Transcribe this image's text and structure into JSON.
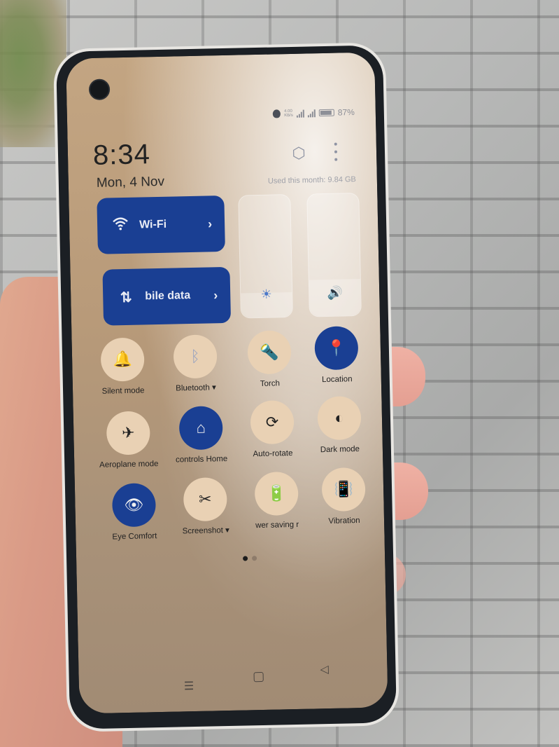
{
  "photo": {
    "subject": "Hand holding smartphone showing quick settings panel over brick pavement"
  },
  "status_bar": {
    "network_speed_top": "4.00",
    "network_speed_bottom": "KB/s",
    "battery_percent": "87%",
    "battery_level": 0.87
  },
  "header": {
    "time": "8:34",
    "date": "Mon, 4 Nov",
    "settings_icon": "gear-hexagon-icon",
    "more_icon": "more-vertical-icon",
    "data_usage": "Used this month: 9.84 GB"
  },
  "big_tiles": [
    {
      "label": "Wi-Fi",
      "icon": "wifi-icon",
      "glyph": "📶",
      "chevron": "›",
      "state": "on"
    },
    {
      "label": "bile data",
      "icon": "mobile-data-arrows-icon",
      "glyph": "⇅",
      "chevron": "›",
      "state": "on"
    }
  ],
  "sliders": {
    "brightness": {
      "icon": "brightness-icon",
      "glyph": "☀",
      "level": 0.2
    },
    "volume": {
      "icon": "volume-icon",
      "glyph": "🔊",
      "level": 0.3
    }
  },
  "quick_settings": [
    {
      "label": "Silent mode",
      "glyph": "🔔",
      "icon": "bell-icon",
      "state": "off"
    },
    {
      "label": "Bluetooth ▾",
      "glyph": "ᛒ",
      "icon": "bluetooth-icon",
      "state": "off"
    },
    {
      "label": "Torch",
      "glyph": "🔦",
      "icon": "torch-icon",
      "state": "off"
    },
    {
      "label": "Location",
      "glyph": "📍",
      "icon": "location-icon",
      "state": "on"
    },
    {
      "label": "Aeroplane mode",
      "glyph": "✈",
      "icon": "aeroplane-icon",
      "state": "off"
    },
    {
      "label": "controls Home",
      "glyph": "⌂",
      "icon": "home-icon",
      "state": "on"
    },
    {
      "label": "Auto-rotate",
      "glyph": "⟳",
      "icon": "auto-rotate-icon",
      "state": "off"
    },
    {
      "label": "Dark mode",
      "glyph": "◐",
      "icon": "dark-mode-icon",
      "state": "off"
    },
    {
      "label": "Eye Comfort",
      "glyph": "👁",
      "icon": "eye-icon",
      "state": "on"
    },
    {
      "label": "Screenshot ▾",
      "glyph": "✂",
      "icon": "screenshot-icon",
      "state": "off"
    },
    {
      "label": "wer saving r",
      "glyph": "🔋",
      "icon": "power-saving-icon",
      "state": "off"
    },
    {
      "label": "Vibration",
      "glyph": "📳",
      "icon": "vibration-off-icon",
      "state": "off"
    }
  ],
  "pager": {
    "current_page": 1,
    "total_pages": 2
  },
  "navigation": {
    "menu_glyph": "☰",
    "back_glyph": "◁"
  },
  "colors": {
    "accent_blue": "#1a3f93",
    "tile_off": "#e9d1b4",
    "screen_tint": "#b89a79"
  }
}
